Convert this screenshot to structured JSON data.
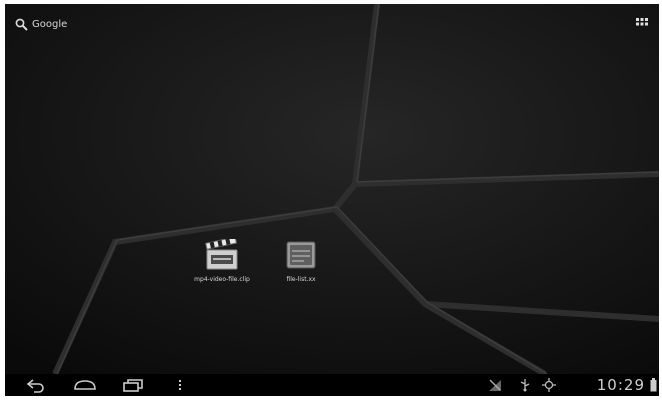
{
  "search": {
    "label": "Google"
  },
  "desktop": {
    "apps": [
      {
        "label": "mp4-video-file.clip",
        "icon": "clapperboard-icon"
      },
      {
        "label": "file-list.xx",
        "icon": "archive-box-icon"
      }
    ]
  },
  "system_bar": {
    "clock": "10:29",
    "status_icons": [
      "no-signal-icon",
      "usb-icon",
      "usb-debug-icon",
      "battery-icon"
    ]
  },
  "colors": {
    "accent": "#33b5e5"
  }
}
